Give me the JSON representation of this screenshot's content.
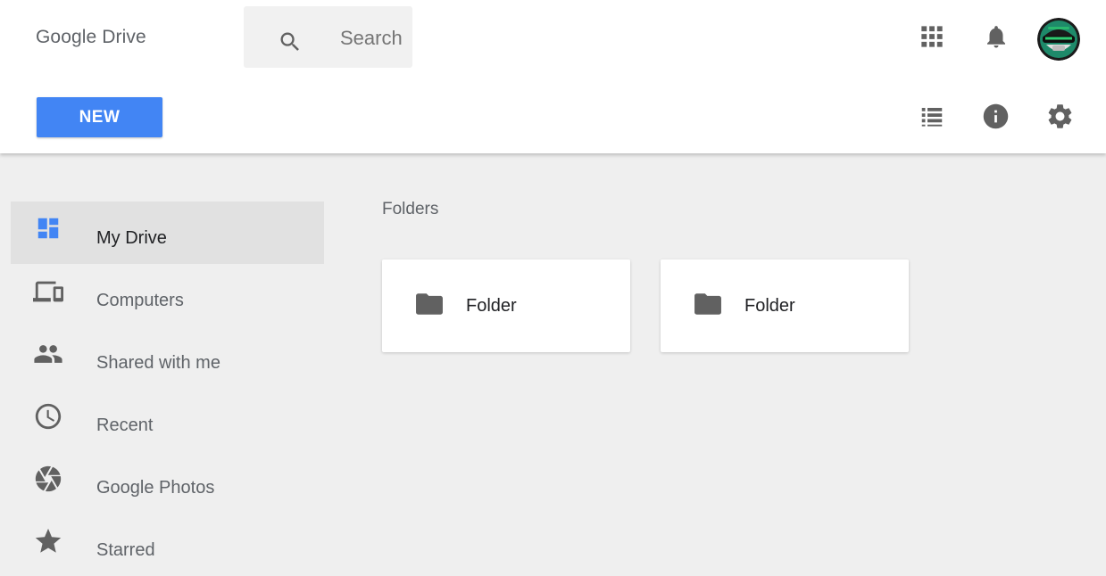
{
  "header": {
    "app_title": "Google Drive",
    "search": {
      "placeholder": "Search",
      "value": ""
    },
    "icons": [
      "apps-grid-icon",
      "notifications-bell-icon",
      "avatar"
    ],
    "new_button_label": "NEW",
    "toolbar_icons": [
      "list-view-icon",
      "info-icon",
      "settings-gear-icon"
    ]
  },
  "sidebar": {
    "items": [
      {
        "label": "My Drive",
        "icon": "my-drive-icon",
        "active": true
      },
      {
        "label": "Computers",
        "icon": "computers-icon",
        "active": false
      },
      {
        "label": "Shared with me",
        "icon": "shared-people-icon",
        "active": false
      },
      {
        "label": "Recent",
        "icon": "clock-icon",
        "active": false
      },
      {
        "label": "Google Photos",
        "icon": "photos-pinwheel-icon",
        "active": false
      },
      {
        "label": "Starred",
        "icon": "star-icon",
        "active": false
      }
    ]
  },
  "main": {
    "section_title": "Folders",
    "folders": [
      {
        "label": "Folder",
        "icon": "folder-icon"
      },
      {
        "label": "Folder",
        "icon": "folder-icon"
      }
    ]
  },
  "colors": {
    "accent": "#4285f4",
    "icon_gray": "#616161",
    "background": "#efefef",
    "active_item": "#e1e1e1"
  }
}
